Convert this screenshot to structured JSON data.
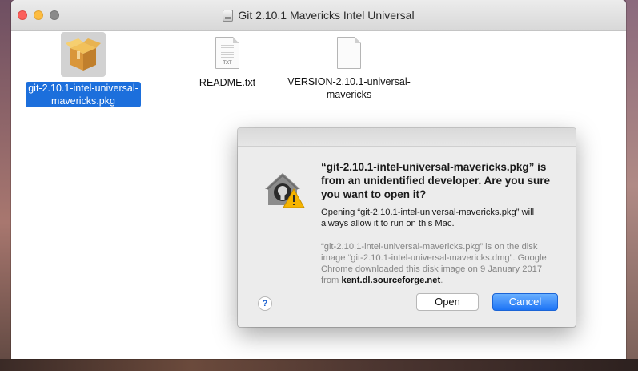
{
  "window": {
    "title": "Git 2.10.1 Mavericks Intel Universal"
  },
  "files": [
    {
      "name_line1": "git-2.10.1-intel-universal-",
      "name_line2": "mavericks.pkg",
      "icon": "package-icon",
      "selected": true
    },
    {
      "name_line1": "README.txt",
      "name_line2": "",
      "icon": "text-document-icon",
      "selected": false,
      "tag": "TXT"
    },
    {
      "name_line1": "VERSION-2.10.1-universal-",
      "name_line2": "mavericks",
      "icon": "document-icon",
      "selected": false
    }
  ],
  "dialog": {
    "heading": "“git-2.10.1-intel-universal-mavericks.pkg” is from an unidentified developer. Are you sure you want to open it?",
    "body": "Opening “git-2.10.1-intel-universal-mavericks.pkg” will always allow it to run on this Mac.",
    "info_prefix": "“git-2.10.1-intel-universal-mavericks.pkg” is on the disk image “git-2.10.1-intel-universal-mavericks.dmg”. Google Chrome downloaded this disk image on 9 January 2017 from",
    "info_source": "kent.dl.sourceforge.net",
    "info_suffix": ".",
    "help_label": "?",
    "open_label": "Open",
    "cancel_label": "Cancel",
    "icon": "gatekeeper-warning-icon"
  },
  "colors": {
    "selection": "#1c6fdc",
    "default_button": "#1c73f5",
    "warning": "#f5b400"
  }
}
